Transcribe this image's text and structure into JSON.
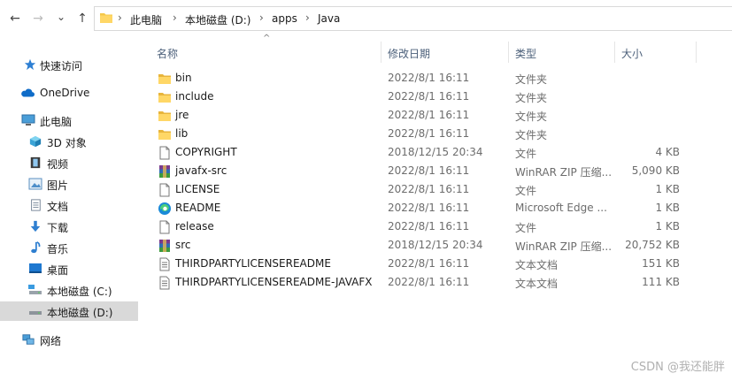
{
  "nav": {
    "back_glyph": "←",
    "forward_glyph": "→",
    "recent_glyph": "⌄",
    "up_glyph": "↑",
    "breadcrumb": [
      "此电脑",
      "本地磁盘 (D:)",
      "apps",
      "Java"
    ],
    "separator": "›",
    "sort_hint": "^"
  },
  "columns": {
    "name": "名称",
    "date": "修改日期",
    "type": "类型",
    "size": "大小"
  },
  "sidebar": {
    "items": [
      {
        "label": "快速访问",
        "icon": "star-icon"
      },
      {
        "label": "OneDrive",
        "icon": "cloud-icon"
      },
      {
        "label": "此电脑",
        "icon": "computer-icon"
      },
      {
        "label": "3D 对象",
        "icon": "cube-icon"
      },
      {
        "label": "视频",
        "icon": "video-icon"
      },
      {
        "label": "图片",
        "icon": "picture-icon"
      },
      {
        "label": "文档",
        "icon": "document-icon"
      },
      {
        "label": "下载",
        "icon": "download-icon"
      },
      {
        "label": "音乐",
        "icon": "music-icon"
      },
      {
        "label": "桌面",
        "icon": "desktop-icon"
      },
      {
        "label": "本地磁盘 (C:)",
        "icon": "drive-icon"
      },
      {
        "label": "本地磁盘 (D:)",
        "icon": "drive-icon"
      },
      {
        "label": "网络",
        "icon": "network-icon"
      }
    ],
    "selected": "本地磁盘 (D:)"
  },
  "files": [
    {
      "name": "bin",
      "date": "2022/8/1 16:11",
      "type": "文件夹",
      "size": "",
      "icon": "folder-icon"
    },
    {
      "name": "include",
      "date": "2022/8/1 16:11",
      "type": "文件夹",
      "size": "",
      "icon": "folder-icon"
    },
    {
      "name": "jre",
      "date": "2022/8/1 16:11",
      "type": "文件夹",
      "size": "",
      "icon": "folder-icon"
    },
    {
      "name": "lib",
      "date": "2022/8/1 16:11",
      "type": "文件夹",
      "size": "",
      "icon": "folder-icon"
    },
    {
      "name": "COPYRIGHT",
      "date": "2018/12/15 20:34",
      "type": "文件",
      "size": "4 KB",
      "icon": "file-icon"
    },
    {
      "name": "javafx-src",
      "date": "2022/8/1 16:11",
      "type": "WinRAR ZIP 压缩...",
      "size": "5,090 KB",
      "icon": "winrar-icon"
    },
    {
      "name": "LICENSE",
      "date": "2022/8/1 16:11",
      "type": "文件",
      "size": "1 KB",
      "icon": "file-icon"
    },
    {
      "name": "README",
      "date": "2022/8/1 16:11",
      "type": "Microsoft Edge ...",
      "size": "1 KB",
      "icon": "edge-icon"
    },
    {
      "name": "release",
      "date": "2022/8/1 16:11",
      "type": "文件",
      "size": "1 KB",
      "icon": "file-icon"
    },
    {
      "name": "src",
      "date": "2018/12/15 20:34",
      "type": "WinRAR ZIP 压缩...",
      "size": "20,752 KB",
      "icon": "winrar-icon"
    },
    {
      "name": "THIRDPARTYLICENSEREADME",
      "date": "2022/8/1 16:11",
      "type": "文本文档",
      "size": "151 KB",
      "icon": "text-file-icon"
    },
    {
      "name": "THIRDPARTYLICENSEREADME-JAVAFX",
      "date": "2022/8/1 16:11",
      "type": "文本文档",
      "size": "111 KB",
      "icon": "text-file-icon"
    }
  ],
  "watermark": "CSDN @我还能胖"
}
